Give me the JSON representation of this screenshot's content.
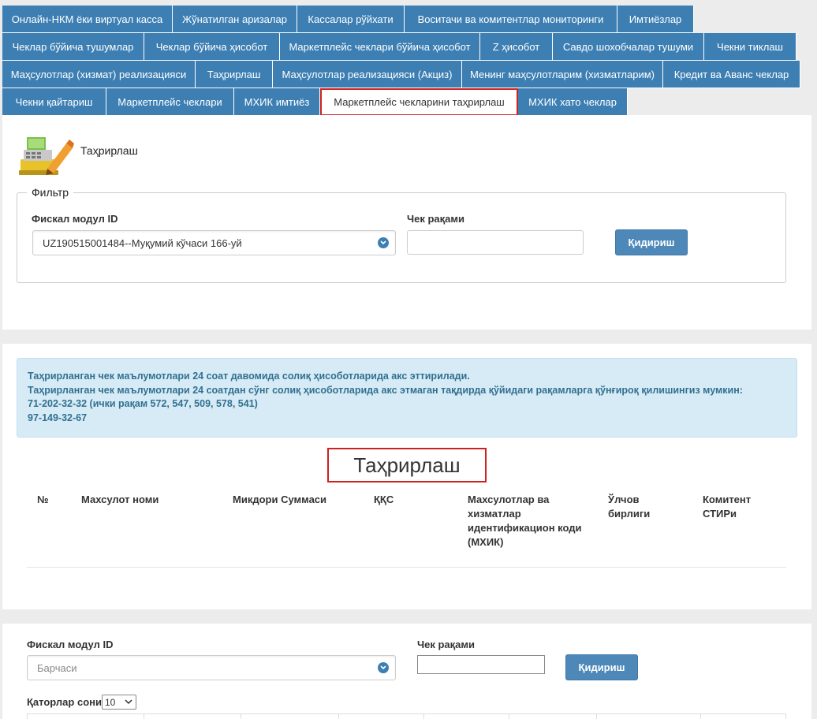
{
  "tabs": {
    "row1": [
      "Онлайн-НКМ ёки виртуал касса",
      "Жўнатилган аризалар",
      "Кассалар рўйхати",
      "Воситачи ва комитентлар мониторинги",
      "Имтиёзлар"
    ],
    "row2": [
      "Чеклар бўйича тушумлар",
      "Чеклар бўйича ҳисобот",
      "Маркетплейс чеклари бўйича ҳисобот",
      "Z ҳисобот",
      "Савдо шохобчалар тушуми",
      "Чекни тиклаш"
    ],
    "row3": [
      "Маҳсулотлар (хизмат) реализацияси",
      "Таҳрирлаш",
      "Маҳсулотлар реализацияси (Акциз)",
      "Менинг маҳсулотларим (хизматларим)",
      "Кредит ва Аванс чеклар"
    ],
    "row4": [
      "Чекни қайтариш",
      "Маркетплейс чеклари",
      "МХИК имтиёз",
      "Маркетплейс чекларини таҳрирлаш",
      "МХИК хато чеклар"
    ]
  },
  "header": {
    "title": "Таҳрирлаш",
    "icon": "cash-register-edit-icon"
  },
  "filter": {
    "legend": "Фильтр",
    "fiscal_label": "Фискал модул ID",
    "fiscal_value": "UZ190515001484--Муқумий кўчаси 166-уй",
    "receipt_label": "Чек рақами",
    "receipt_value": "",
    "search_button": "Қидириш"
  },
  "info": {
    "line1": "Таҳрирланган чек маълумотлари 24 соат давомида солиқ ҳисоботларида акс эттирилади.",
    "line2": "Таҳрирланган чек маълумотлари 24 соатдан сўнг солиқ ҳисоботларида акс этмаган тақдирда қўйидаги рақамларга қўнғироқ қилишингиз мумкин:",
    "line3": "71-202-32-32 (ички рақам 572, 547, 509, 578, 541)",
    "line4": "97-149-32-67"
  },
  "edit_section": {
    "title": "Таҳрирлаш",
    "columns": [
      "№",
      "Махсулот номи",
      "Микдори Суммаси",
      "ҚҚС",
      "Махсулотлар ва хизматлар идентификацион коди (МХИК)",
      "Ўлчов бирлиги",
      "Комитент СТИРи"
    ]
  },
  "bottom": {
    "fiscal_label": "Фискал модул ID",
    "fiscal_placeholder": "Барчаси",
    "receipt_label": "Чек рақами",
    "search_button": "Қидириш",
    "rows_label": "Қаторлар сони",
    "rows_value": "10"
  },
  "colors": {
    "tab": "#3d7fb3",
    "highlight": "#cc2222",
    "info_bg": "#d7ebf7",
    "button": "#4d88b9"
  }
}
